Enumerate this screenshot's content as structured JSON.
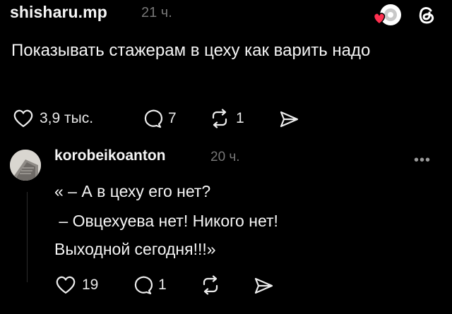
{
  "post": {
    "username": "shisharu.mp",
    "time": "21 ч.",
    "text": "Показывать стажерам в цеху как варить надо",
    "actions": {
      "likes": "3,9 тыс.",
      "comments": "7",
      "reposts": "1"
    }
  },
  "reply": {
    "username": "korobeikoanton",
    "time": "20 ч.",
    "lines": [
      "« – А в цеху его нет?",
      " – Овцехуева нет! Никого нет!",
      "Выходной сегодня!!!»"
    ],
    "actions": {
      "likes": "19",
      "comments": "1"
    }
  },
  "icons": {
    "like": "heart-icon",
    "comment": "comment-bubble-icon",
    "repost": "repost-icon",
    "share": "send-icon",
    "more": "more-dots-icon",
    "logo": "threads-logo-icon"
  },
  "colors": {
    "background": "#000000",
    "text": "#f5f5f5",
    "muted": "#777777",
    "badge_heart": "#ff3050"
  }
}
